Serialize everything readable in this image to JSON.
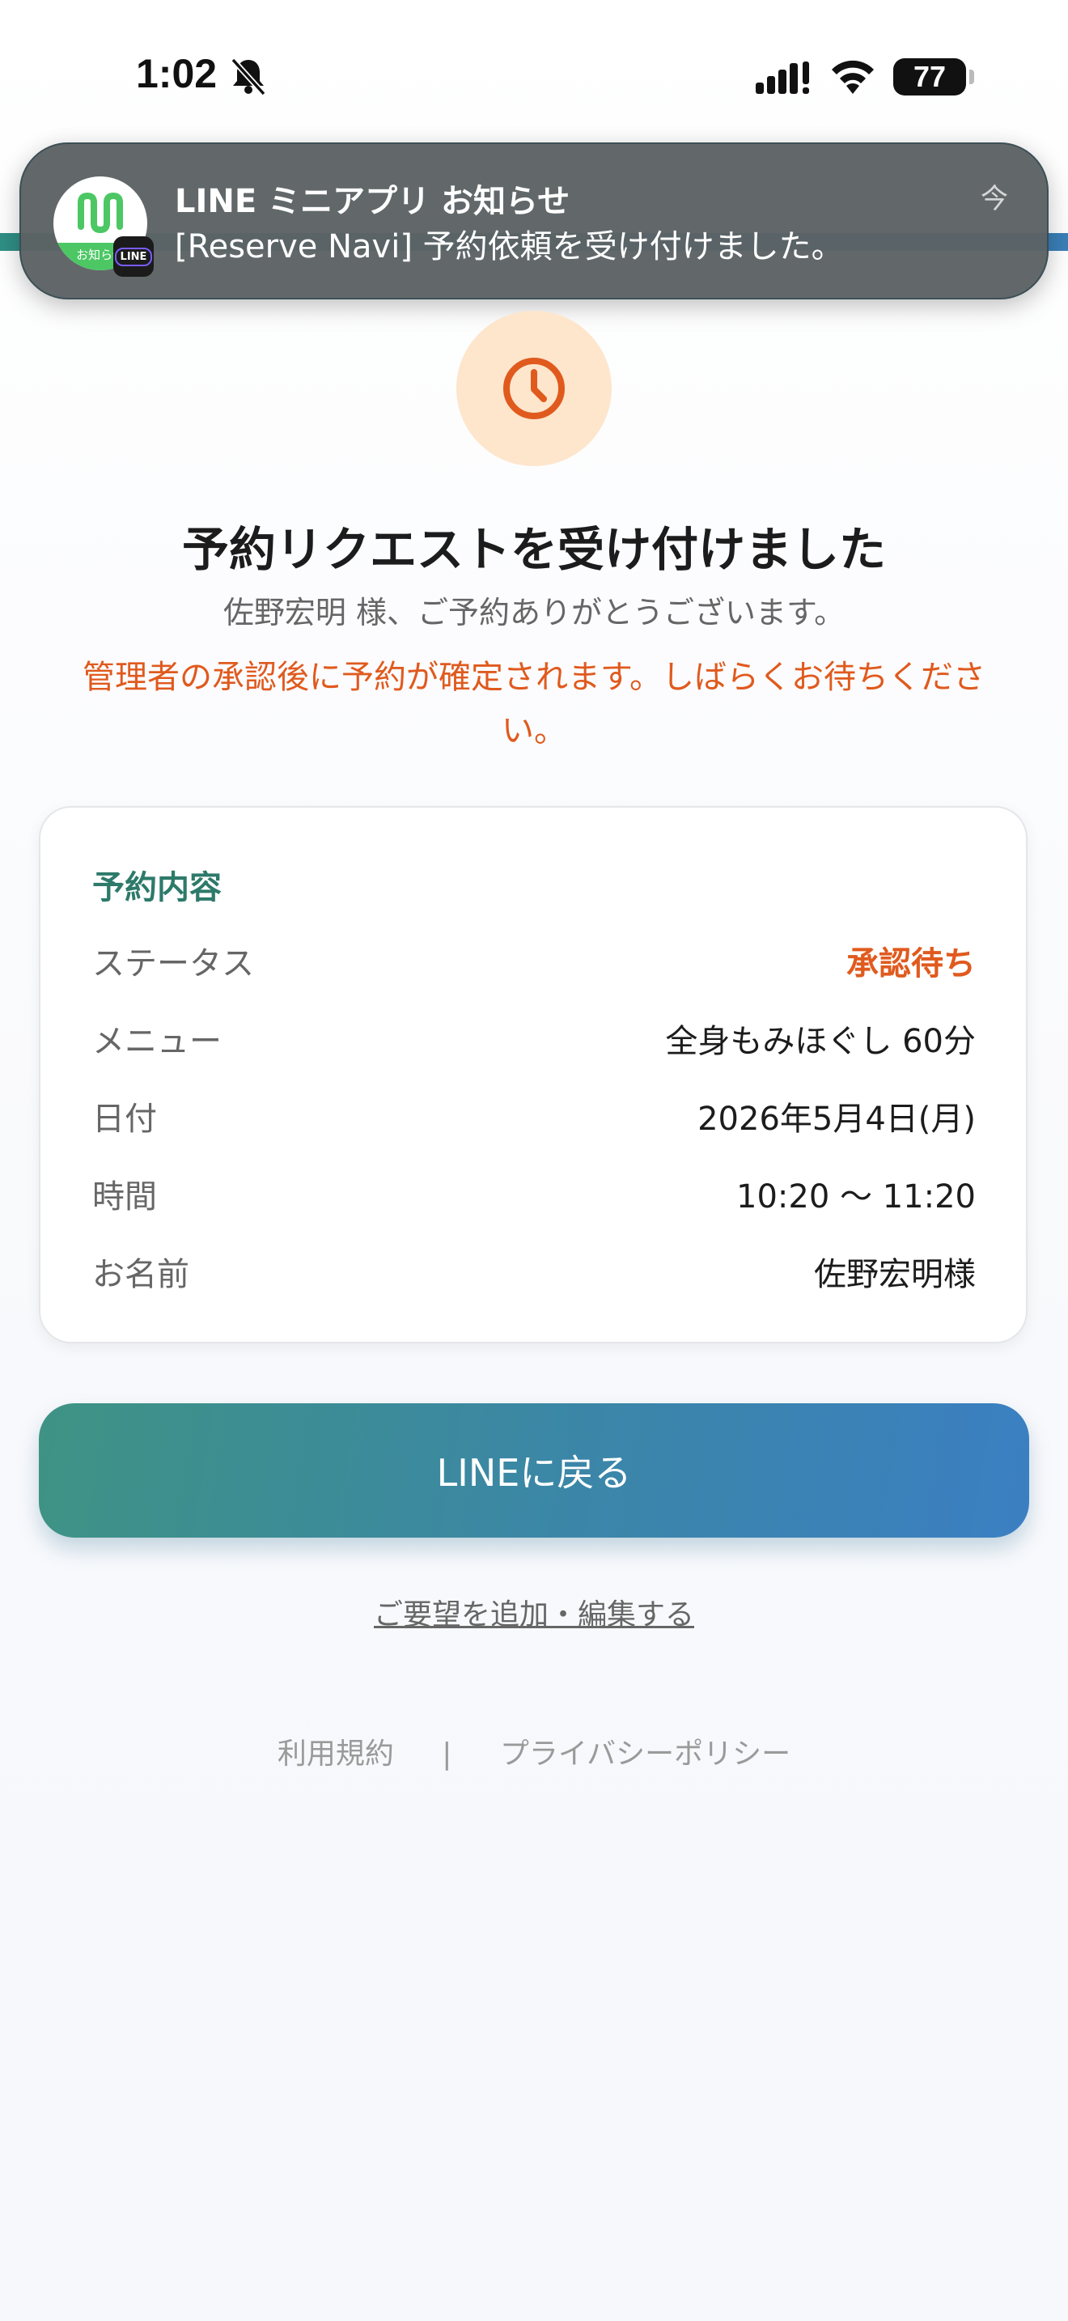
{
  "status_bar": {
    "time": "1:02",
    "battery": "77"
  },
  "notification": {
    "app_name": "LINE ミニアプリ お知らせ",
    "message": "[Reserve Navi] 予約依頼を受け付けました。",
    "time": "今",
    "icon_band_text": "お知らせ",
    "badge_text": "LINE"
  },
  "page": {
    "title": "予約リクエストを受け付けました",
    "thanks": "佐野宏明 様、ご予約ありがとうございます。",
    "notice": "管理者の承認後に予約が確定されます。しばらくお待ちください。"
  },
  "reservation": {
    "heading": "予約内容",
    "rows": [
      {
        "label": "ステータス",
        "value": "承認待ち"
      },
      {
        "label": "メニュー",
        "value": "全身もみほぐし 60分"
      },
      {
        "label": "日付",
        "value": "2026年5月4日(月)"
      },
      {
        "label": "時間",
        "value": "10:20 〜 11:20"
      },
      {
        "label": "お名前",
        "value": "佐野宏明様"
      }
    ]
  },
  "actions": {
    "back_label": "LINEに戻る",
    "edit_label": "ご要望を追加・編集する"
  },
  "footer": {
    "terms": "利用規約",
    "separator": "|",
    "privacy": "プライバシーポリシー"
  },
  "colors": {
    "accent_orange": "#e05a1e",
    "teal": "#2d7a6a",
    "button_start": "#3e9384",
    "button_end": "#3b7fc2"
  },
  "icons": [
    "bell-slash-icon",
    "signal-icon",
    "wifi-icon",
    "battery-icon",
    "clock-icon",
    "line-app-icon"
  ]
}
